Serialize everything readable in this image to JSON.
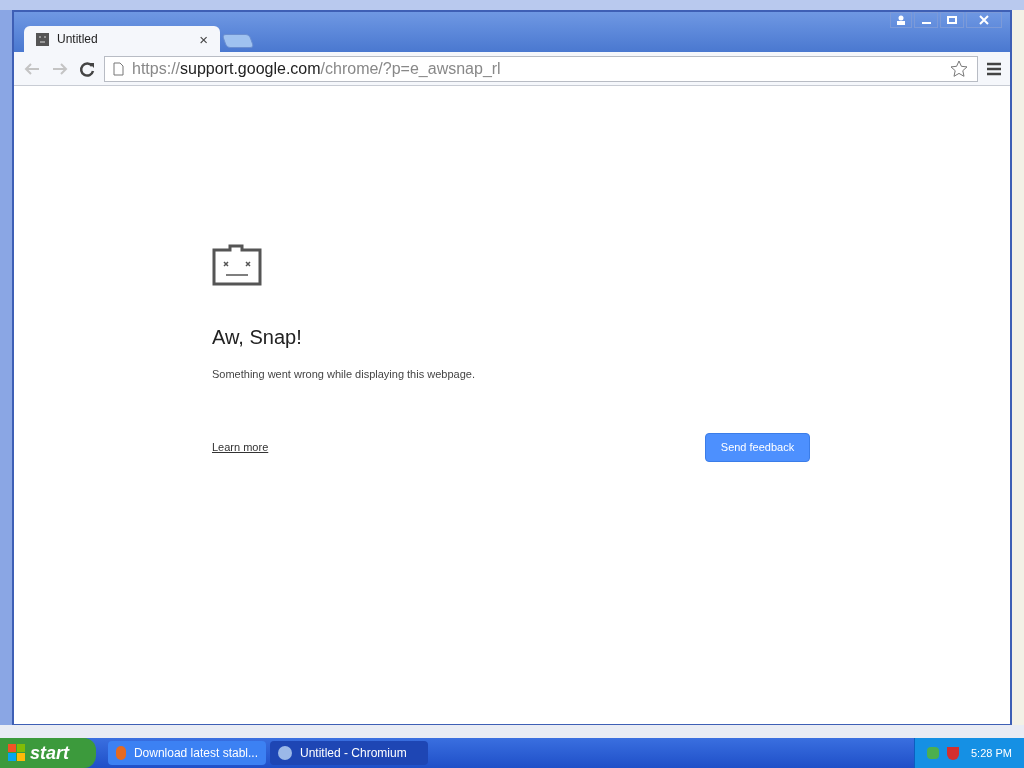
{
  "tabs": [
    {
      "title": "Untitled",
      "selected": true,
      "close": "×"
    }
  ],
  "address_bar": {
    "scheme": "https://",
    "host": "support.google.com",
    "path": "/chrome/?p=e_awsnap_rl"
  },
  "page": {
    "heading": "Aw, Snap!",
    "message": "Something went wrong while displaying this webpage.",
    "link": "Learn more",
    "button": "Send feedback"
  },
  "taskbar": {
    "start": "start",
    "items": [
      {
        "label": "Download latest stabl...",
        "selected": false
      },
      {
        "label": "Untitled - Chromium",
        "selected": true
      }
    ],
    "clock": "5:28 PM"
  }
}
